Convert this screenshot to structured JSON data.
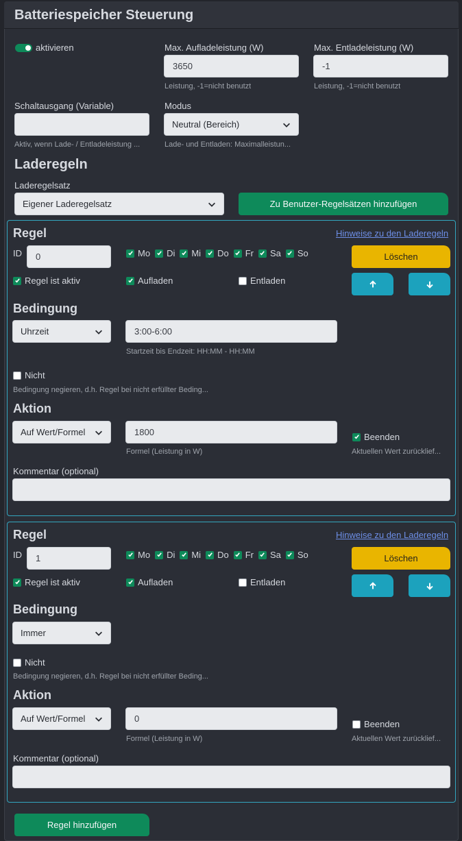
{
  "header": {
    "title": "Batteriespeicher Steuerung"
  },
  "settings": {
    "activate_label": "aktivieren",
    "max_charge": {
      "label": "Max. Aufladeleistung (W)",
      "value": "3650",
      "help": "Leistung, -1=nicht benutzt"
    },
    "max_discharge": {
      "label": "Max. Entladeleistung (W)",
      "value": "-1",
      "help": "Leistung, -1=nicht benutzt"
    },
    "switch_output": {
      "label": "Schaltausgang (Variable)",
      "value": "",
      "help": "Aktiv, wenn Lade- / Entladeleistung ..."
    },
    "mode": {
      "label": "Modus",
      "value": "Neutral (Bereich)",
      "help": "Lade- und Entladen: Maximalleistun..."
    }
  },
  "charge_rules": {
    "title": "Laderegeln",
    "ruleset_label": "Laderegelsatz",
    "ruleset_value": "Eigener Laderegelsatz",
    "add_to_user_sets_label": "Zu Benutzer-Regelsätzen hinzufügen"
  },
  "rule_labels": {
    "title": "Regel",
    "hints_link": "Hinweise zu den Laderegeln",
    "id_label": "ID",
    "days": [
      "Mo",
      "Di",
      "Mi",
      "Do",
      "Fr",
      "Sa",
      "So"
    ],
    "delete_label": "Löschen",
    "active_label": "Regel ist aktiv",
    "charge_label": "Aufladen",
    "discharge_label": "Entladen",
    "condition_title": "Bedingung",
    "not_label": "Nicht",
    "not_help": "Bedingung negieren, d.h. Regel bei nicht erfüllter Beding...",
    "action_title": "Aktion",
    "formula_help": "Formel (Leistung in W)",
    "end_label": "Beenden",
    "end_help": "Aktuellen Wert zurücklief...",
    "comment_label": "Kommentar (optional)"
  },
  "rules": [
    {
      "id": "0",
      "days_checked": [
        true,
        true,
        true,
        true,
        true,
        true,
        true
      ],
      "active": true,
      "charge": true,
      "discharge": false,
      "condition": "Uhrzeit",
      "condition_value": "3:00-6:00",
      "condition_help": "Startzeit bis Endzeit: HH:MM - HH:MM",
      "negate": false,
      "action": "Auf Wert/Formel",
      "formula": "1800",
      "end": true,
      "comment": ""
    },
    {
      "id": "1",
      "days_checked": [
        true,
        true,
        true,
        true,
        true,
        true,
        true
      ],
      "active": true,
      "charge": true,
      "discharge": false,
      "condition": "Immer",
      "negate": false,
      "action": "Auf Wert/Formel",
      "formula": "0",
      "end": false,
      "comment": ""
    }
  ],
  "footer": {
    "add_rule_label": "Regel hinzufügen"
  },
  "colors": {
    "accent_green": "#0e8a5a",
    "accent_yellow": "#e9b500",
    "accent_cyan": "#1ca2bd",
    "card_border": "#33a7c0"
  }
}
